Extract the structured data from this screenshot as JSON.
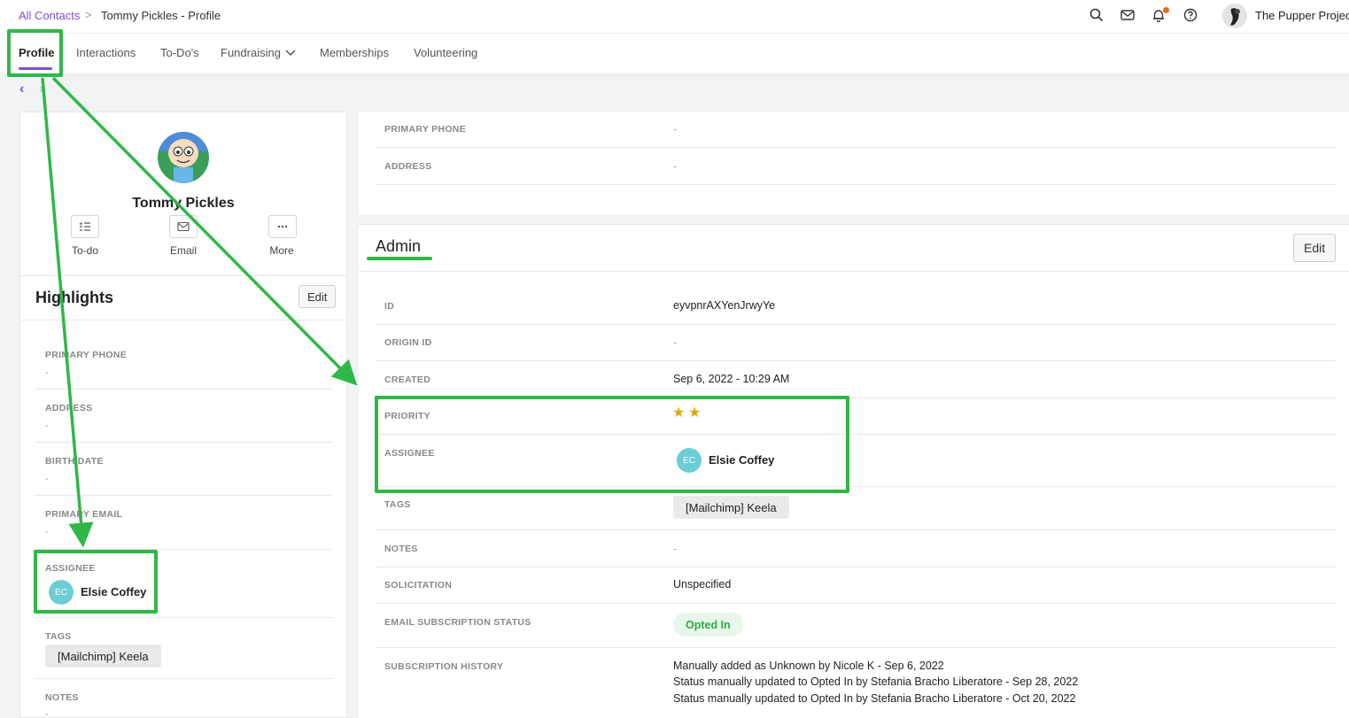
{
  "breadcrumb": {
    "root": "All Contacts",
    "separator": ">",
    "current": "Tommy Pickles - Profile"
  },
  "topbar": {
    "org_name": "The Pupper Project",
    "icons": [
      "search-icon",
      "mail-icon",
      "bell-icon",
      "help-icon"
    ]
  },
  "tabs": [
    {
      "label": "Profile",
      "active": true
    },
    {
      "label": "Interactions"
    },
    {
      "label": "To-Do's"
    },
    {
      "label": "Fundraising"
    },
    {
      "label": "Memberships"
    },
    {
      "label": "Volunteering"
    }
  ],
  "contact": {
    "name": "Tommy Pickles",
    "actions": [
      {
        "label": "To-do",
        "icon": "checklist-icon"
      },
      {
        "label": "Email",
        "icon": "mail-icon"
      },
      {
        "label": "More",
        "icon": "more-icon"
      }
    ]
  },
  "highlights": {
    "title": "Highlights",
    "edit_label": "Edit",
    "fields": [
      {
        "label": "PRIMARY PHONE",
        "value": "-"
      },
      {
        "label": "ADDRESS",
        "value": "-"
      },
      {
        "label": "BIRTH DATE",
        "value": "-"
      },
      {
        "label": "PRIMARY EMAIL",
        "value": "-"
      }
    ],
    "assignee": {
      "label": "ASSIGNEE",
      "initials": "EC",
      "name": "Elsie Coffey"
    },
    "tags": {
      "label": "TAGS",
      "value": "[Mailchimp] Keela"
    },
    "notes": {
      "label": "NOTES",
      "value": "-"
    }
  },
  "contact_info": {
    "fields": [
      {
        "label": "PRIMARY PHONE",
        "value": "-"
      },
      {
        "label": "ADDRESS",
        "value": "-"
      }
    ]
  },
  "admin": {
    "title": "Admin",
    "edit_label": "Edit",
    "id": {
      "label": "ID",
      "value": "eyvpnrAXYenJrwyYe"
    },
    "origin_id": {
      "label": "ORIGIN ID",
      "value": "-"
    },
    "created": {
      "label": "CREATED",
      "value": "Sep 6, 2022 - 10:29 AM"
    },
    "priority": {
      "label": "PRIORITY",
      "stars": 2,
      "star_glyph": "★",
      "star_color": "#e0a800"
    },
    "assignee": {
      "label": "ASSIGNEE",
      "initials": "EC",
      "name": "Elsie Coffey"
    },
    "tags": {
      "label": "TAGS",
      "value": "[Mailchimp] Keela"
    },
    "notes": {
      "label": "NOTES",
      "value": "-"
    },
    "solicitation": {
      "label": "SOLICITATION",
      "value": "Unspecified"
    },
    "email_status": {
      "label": "EMAIL SUBSCRIPTION STATUS",
      "value": "Opted In"
    },
    "subscription_history": {
      "label": "SUBSCRIPTION HISTORY",
      "lines": [
        "Manually added as Unknown by Nicole K - Sep 6, 2022",
        "Status manually updated to Opted In by Stefania Bracho Liberatore - Sep 28, 2022",
        "Status manually updated to Opted In by Stefania Bracho Liberatore - Oct 20, 2022"
      ]
    }
  },
  "colors": {
    "accent": "#7b4fd1",
    "annotation": "#2fb847",
    "avatar": "#6ccdd6",
    "badge_green": "#2fa84f"
  }
}
